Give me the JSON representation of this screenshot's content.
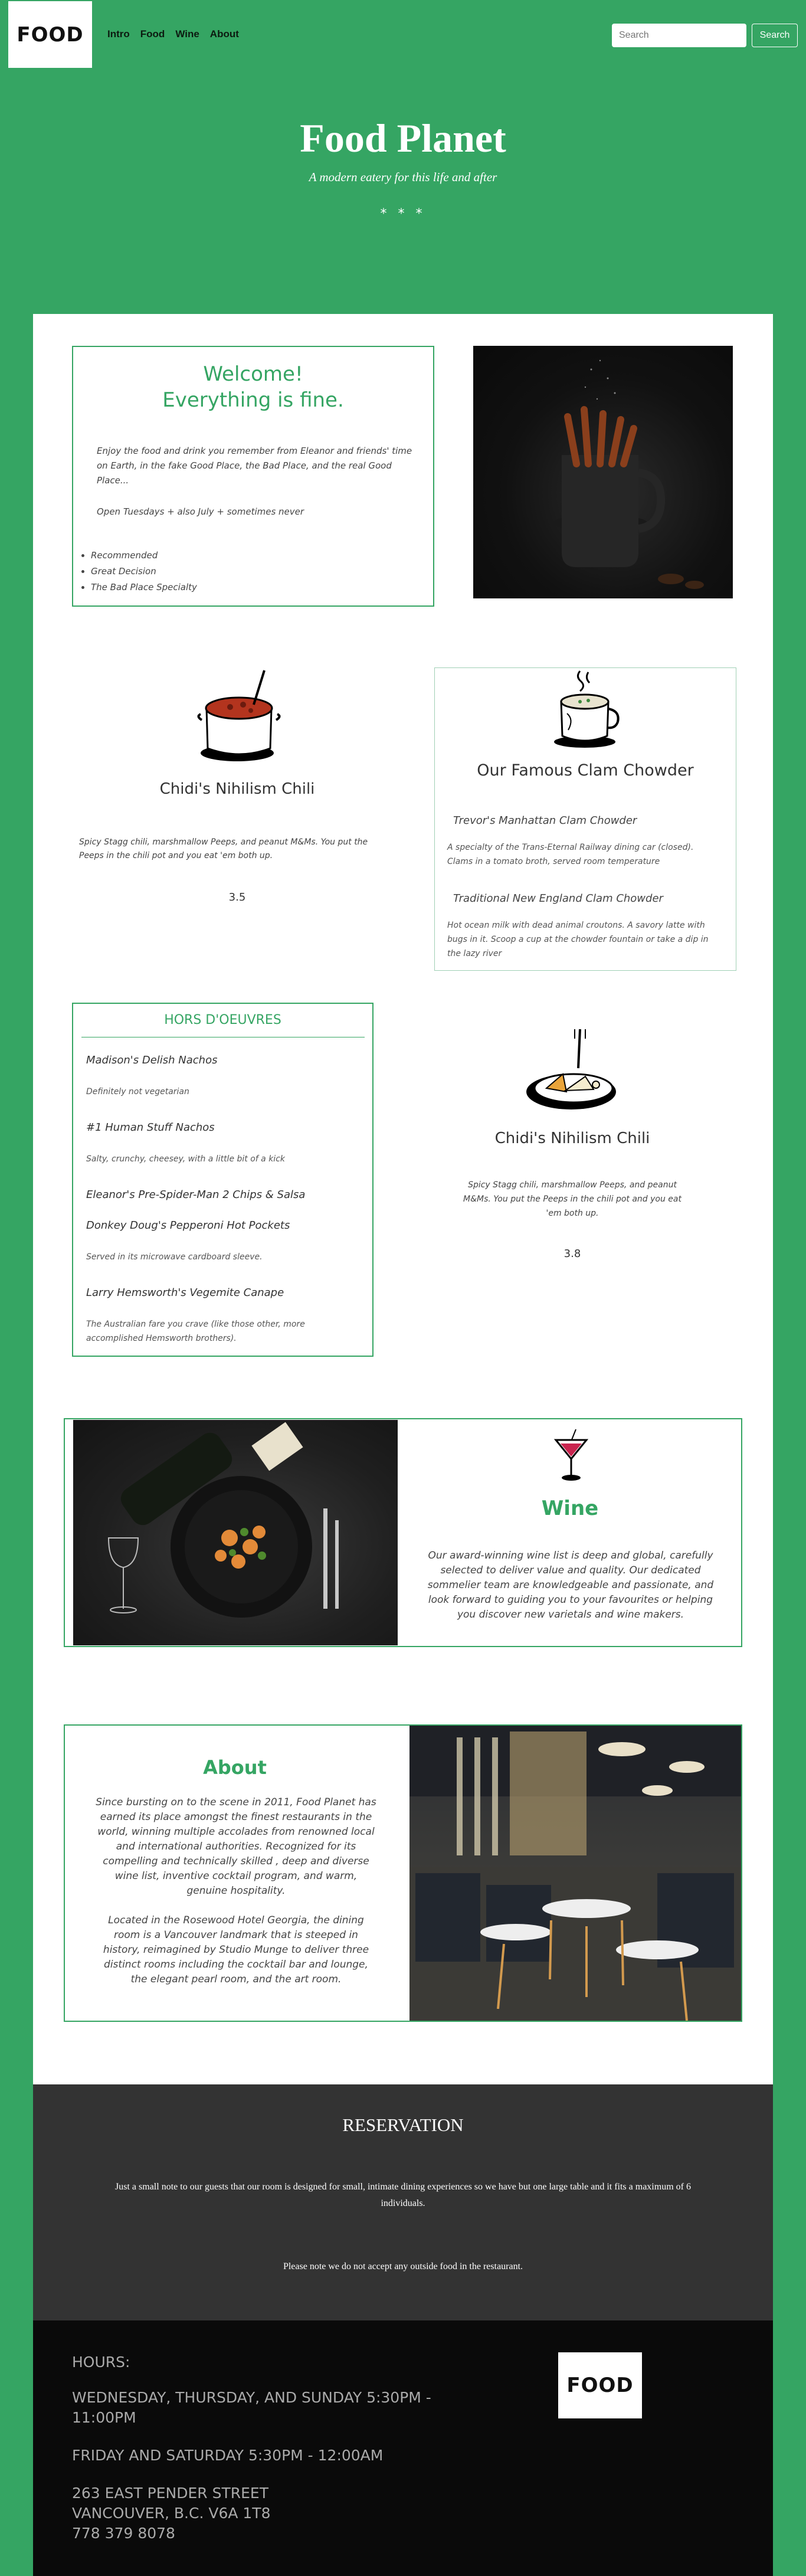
{
  "nav": {
    "logo": "FOOD",
    "links": [
      "Intro",
      "Food",
      "Wine",
      "About"
    ],
    "search_placeholder": "Search",
    "search_button": "Search"
  },
  "hero": {
    "title": "Food Planet",
    "subtitle": "A modern eatery for this life and after",
    "stars": "* * *"
  },
  "welcome": {
    "title_line1": "Welcome!",
    "title_line2": "Everything is fine.",
    "body": "Enjoy the food and drink you remember from Eleanor and friends' time on Earth, in the fake Good Place, the Bad Place, and the real Good Place...",
    "hours": "Open Tuesdays + also July + sometimes never",
    "list": [
      "Recommended",
      "Great Decision",
      "The Bad Place Specialty"
    ]
  },
  "chili1": {
    "title": "Chidi's Nihilism Chili",
    "desc": "Spicy Stagg chili, marshmallow Peeps, and peanut M&Ms. You put the Peeps in the chili pot and you eat 'em both up.",
    "rating": "3.5"
  },
  "clam": {
    "title": "Our Famous Clam Chowder",
    "items": [
      {
        "name": "Trevor's Manhattan Clam Chowder",
        "desc": "A specialty of the Trans-Eternal Railway dining car (closed). Clams in a tomato broth, served room temperature"
      },
      {
        "name": "Traditional New England Clam Chowder",
        "desc": "Hot ocean milk with dead animal croutons. A savory latte with bugs in it. Scoop a cup at the chowder fountain or take a dip in the lazy river"
      }
    ]
  },
  "hors": {
    "title": "HORS D'OEUVRES",
    "items": [
      {
        "name": "Madison's Delish Nachos",
        "desc": "Definitely not vegetarian"
      },
      {
        "name": "#1 Human Stuff Nachos",
        "desc": "Salty, crunchy, cheesey, with a little bit of a kick"
      },
      {
        "name": "Eleanor's Pre-Spider-Man 2 Chips & Salsa",
        "desc": ""
      },
      {
        "name": "Donkey Doug's Pepperoni Hot Pockets",
        "desc": "Served in its microwave cardboard sleeve."
      },
      {
        "name": "Larry Hemsworth's Vegemite Canape",
        "desc": "The Australian fare you crave (like those other, more accomplished Hemsworth brothers)."
      }
    ]
  },
  "chili2": {
    "title": "Chidi's Nihilism Chili",
    "desc": "Spicy Stagg chili, marshmallow Peeps, and peanut M&Ms. You put the Peeps in the chili pot and you eat 'em both up.",
    "rating": "3.8"
  },
  "wine": {
    "title": "Wine",
    "body": "Our award-winning wine list is deep and global, carefully selected to deliver value and quality. Our dedicated sommelier team are knowledgeable and passionate, and look forward to guiding you to your favourites or helping you discover new varietals and wine makers."
  },
  "about": {
    "title": "About",
    "para1": "Since bursting on to the scene in 2011, Food Planet has earned its place amongst the finest restaurants in the world, winning multiple accolades from renowned local and international authorities. Recognized for its compelling and technically skilled , deep and diverse wine list, inventive cocktail program, and warm, genuine hospitality.",
    "para2": "Located in the Rosewood Hotel Georgia, the dining room is a Vancouver landmark that is steeped in history, reimagined by Studio Munge to deliver three distinct rooms including the cocktail bar and lounge, the elegant pearl room, and the art room."
  },
  "reservation": {
    "title": "RESERVATION",
    "note1": "Just a small note to our guests that our room is designed for small, intimate dining experiences so we have but one large table and it fits a maximum of 6 individuals.",
    "note2": "Please note we do not accept any outside food in the restaurant."
  },
  "footer": {
    "hours_label": "HOURS:",
    "hours1": "WEDNESDAY, THURSDAY, AND SUNDAY 5:30PM - 11:00PM",
    "hours2": "FRIDAY AND SATURDAY 5:30PM - 12:00AM",
    "address1": "263 EAST PENDER STREET",
    "address2": "VANCOUVER, B.C. V6A 1T8",
    "phone": "778 379 8078",
    "logo": "FOOD"
  },
  "colors": {
    "brand_green": "#35a563",
    "dark_panel": "#333333",
    "footer_bg": "#0a0a0a"
  }
}
